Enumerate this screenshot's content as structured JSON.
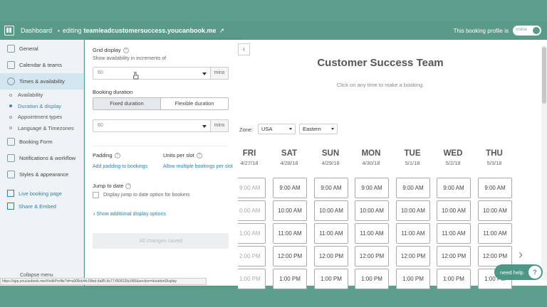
{
  "topbar": {
    "dashboard": "Dashboard",
    "separator": "•",
    "editing": "editing",
    "domain": "teamleadcustomersuccess.youcanbook.me",
    "profile_label": "This booking profile is",
    "toggle_state": "online"
  },
  "sidebar": {
    "items": [
      {
        "label": "General"
      },
      {
        "label": "Calendar & teams"
      },
      {
        "label": "Times & availability"
      }
    ],
    "subitems": [
      {
        "label": "Availability"
      },
      {
        "label": "Duration & display"
      },
      {
        "label": "Appointment types"
      },
      {
        "label": "Language & Timezones"
      }
    ],
    "items2": [
      {
        "label": "Booking Form"
      },
      {
        "label": "Notifications & workflow"
      },
      {
        "label": "Styles & appearance"
      }
    ],
    "links": [
      {
        "label": "Live booking page"
      },
      {
        "label": "Share & Embed"
      }
    ],
    "collapse": "Collapse menu"
  },
  "panel": {
    "grid_display": "Grid display",
    "grid_help": "Show availability in increments of",
    "grid_value": "60",
    "grid_unit": "mins",
    "booking_duration": "Booking duration",
    "fixed": "Fixed duration",
    "flexible": "Flexible duration",
    "duration_value": "60",
    "duration_unit": "mins",
    "padding": "Padding",
    "padding_link": "Add padding to bookings",
    "units": "Units per slot",
    "units_link": "Allow multiple bookings per slot",
    "jump": "Jump to date",
    "jump_option": "Display jump to date option for bookers",
    "show_more": "Show additional display options",
    "saved": "All changes saved",
    "help_glyph": "?"
  },
  "preview": {
    "title": "Customer Success Team",
    "subtitle": "Click on any time to make a booking.",
    "collapse_glyph": "‹",
    "tz_label": "Zone:",
    "tz_country": "USA",
    "tz_zone": "Eastern",
    "days": [
      {
        "name": "FRI",
        "date": "4/27/18"
      },
      {
        "name": "SAT",
        "date": "4/28/18"
      },
      {
        "name": "SUN",
        "date": "4/29/18"
      },
      {
        "name": "MON",
        "date": "4/30/18"
      },
      {
        "name": "TUE",
        "date": "5/1/18"
      },
      {
        "name": "WED",
        "date": "5/2/18"
      },
      {
        "name": "THU",
        "date": "5/3/18"
      }
    ],
    "times": [
      "9:00 AM",
      "10:00 AM",
      "11:00 AM",
      "12:00 PM",
      "1:00 PM"
    ],
    "cut_times": [
      "9:00 AM",
      "0:00 AM",
      "1:00 AM",
      "2:00 PM",
      "1:00 PM"
    ],
    "next_glyph": "›"
  },
  "help_button": {
    "label": "need help",
    "glyph": "?"
  },
  "statusbar": "https://app.youcanbook.me/#/editProfile?id=a909cb4b-58ed-4a85-9c77-f50812fa1f66&section=durationDisplay"
}
